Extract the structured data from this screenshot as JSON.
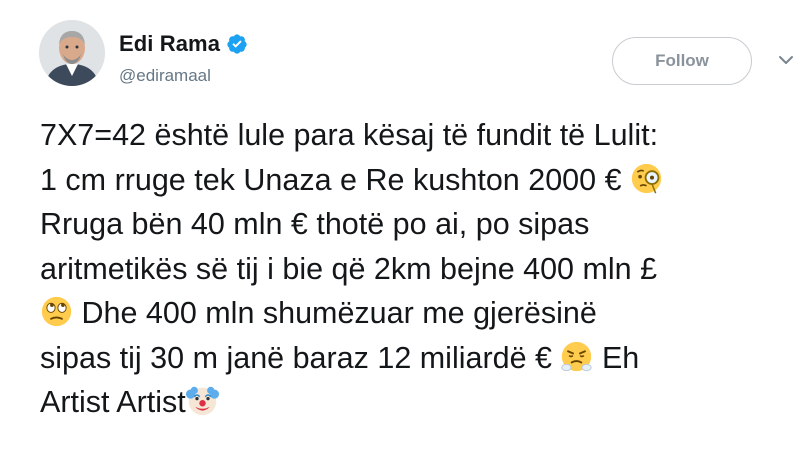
{
  "header": {
    "display_name": "Edi Rama",
    "handle": "@ediramaal",
    "follow_label": "Follow",
    "verified": true
  },
  "tweet": {
    "lines": [
      {
        "text": "7X7=42 është lule para kësaj të fundit të Lulit:",
        "emoji": ""
      },
      {
        "text": "1 cm rruge tek Unaza e Re kushton 2000 €",
        "emoji": "face-with-monocle"
      },
      {
        "text": "Rruga bën 40 mln € thotë po ai, po sipas",
        "emoji": ""
      },
      {
        "text": "aritmetikës së tij i bie që 2km bejne 400 mln £",
        "emoji": ""
      },
      {
        "text": " Dhe 400 mln shumëzuar me gjerësinë",
        "emoji": "face-with-rolling-eyes",
        "emoji_first": true
      },
      {
        "text": "sipas tij 30 m janë baraz 12 miliardë €",
        "emoji": "face-with-steam-from-nose",
        "tail": " Eh"
      },
      {
        "text": "Artist Artist",
        "emoji": "clown-face"
      }
    ]
  },
  "colors": {
    "text": "#14171a",
    "secondary": "#657786",
    "verified_blue": "#1da1f2",
    "follow_border": "#c8ccd0",
    "follow_text": "#8a939b"
  }
}
